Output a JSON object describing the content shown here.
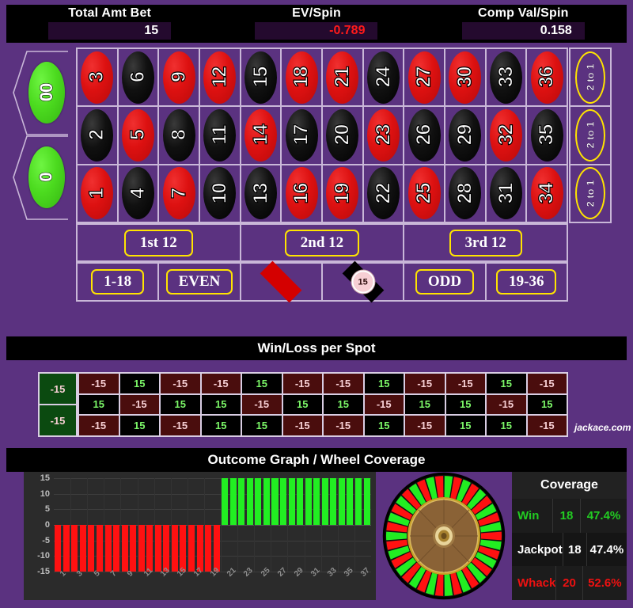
{
  "header": {
    "cells": [
      {
        "label": "Total Amt Bet",
        "value": "15",
        "negative": false
      },
      {
        "label": "EV/Spin",
        "value": "-0.789",
        "negative": true
      },
      {
        "label": "Comp Val/Spin",
        "value": "0.158",
        "negative": false
      }
    ]
  },
  "table": {
    "zeros": [
      {
        "label": "00"
      },
      {
        "label": "0"
      }
    ],
    "rows": [
      [
        {
          "n": "3",
          "c": "red"
        },
        {
          "n": "6",
          "c": "black"
        },
        {
          "n": "9",
          "c": "red"
        },
        {
          "n": "12",
          "c": "red"
        },
        {
          "n": "15",
          "c": "black"
        },
        {
          "n": "18",
          "c": "red"
        },
        {
          "n": "21",
          "c": "red"
        },
        {
          "n": "24",
          "c": "black"
        },
        {
          "n": "27",
          "c": "red"
        },
        {
          "n": "30",
          "c": "red"
        },
        {
          "n": "33",
          "c": "black"
        },
        {
          "n": "36",
          "c": "red"
        }
      ],
      [
        {
          "n": "2",
          "c": "black"
        },
        {
          "n": "5",
          "c": "red"
        },
        {
          "n": "8",
          "c": "black"
        },
        {
          "n": "11",
          "c": "black"
        },
        {
          "n": "14",
          "c": "red"
        },
        {
          "n": "17",
          "c": "black"
        },
        {
          "n": "20",
          "c": "black"
        },
        {
          "n": "23",
          "c": "red"
        },
        {
          "n": "26",
          "c": "black"
        },
        {
          "n": "29",
          "c": "black"
        },
        {
          "n": "32",
          "c": "red"
        },
        {
          "n": "35",
          "c": "black"
        }
      ],
      [
        {
          "n": "1",
          "c": "red"
        },
        {
          "n": "4",
          "c": "black"
        },
        {
          "n": "7",
          "c": "red"
        },
        {
          "n": "10",
          "c": "black"
        },
        {
          "n": "13",
          "c": "black"
        },
        {
          "n": "16",
          "c": "red"
        },
        {
          "n": "19",
          "c": "red"
        },
        {
          "n": "22",
          "c": "black"
        },
        {
          "n": "25",
          "c": "red"
        },
        {
          "n": "28",
          "c": "black"
        },
        {
          "n": "31",
          "c": "black"
        },
        {
          "n": "34",
          "c": "red"
        }
      ]
    ],
    "column_bets": [
      "2 to 1",
      "2 to 1",
      "2 to 1"
    ],
    "dozens": [
      "1st 12",
      "2nd 12",
      "3rd 12"
    ],
    "outside": [
      {
        "type": "text",
        "label": "1-18"
      },
      {
        "type": "text",
        "label": "EVEN"
      },
      {
        "type": "diamond",
        "color": "red",
        "label": "",
        "chip": ""
      },
      {
        "type": "diamond",
        "color": "black",
        "label": "",
        "chip": "15"
      },
      {
        "type": "text",
        "label": "ODD"
      },
      {
        "type": "text",
        "label": "19-36"
      }
    ]
  },
  "winloss": {
    "title": "Win/Loss per Spot",
    "zero_values": [
      "-15",
      "-15"
    ],
    "rows": [
      [
        "-15",
        "15",
        "-15",
        "-15",
        "15",
        "-15",
        "-15",
        "15",
        "-15",
        "-15",
        "15",
        "-15"
      ],
      [
        "15",
        "-15",
        "15",
        "15",
        "-15",
        "15",
        "15",
        "-15",
        "15",
        "15",
        "-15",
        "15"
      ],
      [
        "-15",
        "15",
        "-15",
        "15",
        "15",
        "-15",
        "-15",
        "15",
        "-15",
        "15",
        "15",
        "-15"
      ]
    ],
    "watermark": "jackace.com"
  },
  "outcome": {
    "title": "Outcome Graph / Wheel Coverage",
    "coverage": {
      "title": "Coverage",
      "rows": [
        {
          "name": "Win",
          "count": "18",
          "pct": "47.4%",
          "cls": "cw"
        },
        {
          "name": "Jackpot",
          "count": "18",
          "pct": "47.4%",
          "cls": "cj"
        },
        {
          "name": "Whack",
          "count": "20",
          "pct": "52.6%",
          "cls": "ck"
        }
      ]
    }
  },
  "chart_data": {
    "type": "bar",
    "title": "Outcome Graph / Wheel Coverage",
    "xlabel": "",
    "ylabel": "",
    "ylim": [
      -15,
      15
    ],
    "yticks": [
      15,
      10,
      5,
      0,
      -5,
      -10,
      -15
    ],
    "grid": true,
    "legend": "none",
    "xticks": [
      "1",
      "3",
      "5",
      "7",
      "9",
      "11",
      "13",
      "15",
      "17",
      "19",
      "21",
      "23",
      "25",
      "27",
      "29",
      "31",
      "33",
      "35",
      "37"
    ],
    "categories": [
      "1",
      "2",
      "3",
      "4",
      "5",
      "6",
      "7",
      "8",
      "9",
      "10",
      "11",
      "12",
      "13",
      "14",
      "15",
      "16",
      "17",
      "18",
      "19",
      "20",
      "21",
      "22",
      "23",
      "24",
      "25",
      "26",
      "27",
      "28",
      "29",
      "30",
      "31",
      "32",
      "33",
      "34",
      "35",
      "36",
      "37",
      "38"
    ],
    "values": [
      -15,
      -15,
      -15,
      -15,
      -15,
      -15,
      -15,
      -15,
      -15,
      -15,
      -15,
      -15,
      -15,
      -15,
      -15,
      -15,
      -15,
      -15,
      -15,
      -15,
      15,
      15,
      15,
      15,
      15,
      15,
      15,
      15,
      15,
      15,
      15,
      15,
      15,
      15,
      15,
      15,
      15,
      15
    ],
    "colors": {
      "positive": "#22ee22",
      "negative": "#ff1111"
    }
  },
  "wheel": {
    "segments": 38,
    "colors": [
      "#22ee22",
      "#ff1111"
    ]
  },
  "palette": {
    "felt": "#5b3280",
    "panel_black": "#000000",
    "chip_yellow": "#ffe400",
    "win_green": "#7cf768",
    "loss_red": "#4a0d0d"
  }
}
